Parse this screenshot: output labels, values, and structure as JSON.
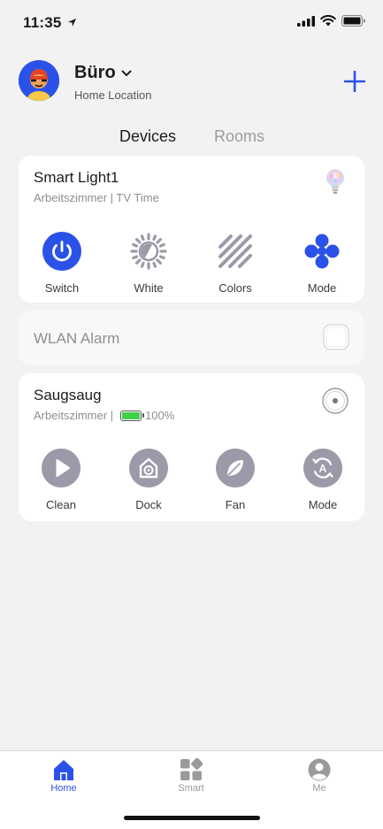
{
  "status_bar": {
    "time": "11:35"
  },
  "header": {
    "home_name": "Büro",
    "home_subtitle": "Home Location"
  },
  "tabs": [
    {
      "label": "Devices",
      "active": true
    },
    {
      "label": "Rooms",
      "active": false
    }
  ],
  "devices": [
    {
      "name": "Smart Light1",
      "subtitle": "Arbeitszimmer | TV Time",
      "actions": [
        {
          "label": "Switch",
          "icon": "power-icon",
          "active": true
        },
        {
          "label": "White",
          "icon": "brightness-icon"
        },
        {
          "label": "Colors",
          "icon": "stripes-icon"
        },
        {
          "label": "Mode",
          "icon": "mode-dots-icon",
          "active": true
        }
      ]
    },
    {
      "name": "WLAN Alarm"
    },
    {
      "name": "Saugsaug",
      "subtitle": "Arbeitszimmer |",
      "battery": "100%",
      "actions": [
        {
          "label": "Clean",
          "icon": "play-icon"
        },
        {
          "label": "Dock",
          "icon": "dock-icon"
        },
        {
          "label": "Fan",
          "icon": "leaf-icon"
        },
        {
          "label": "Mode",
          "icon": "auto-mode-icon"
        }
      ]
    }
  ],
  "bottom_nav": [
    {
      "label": "Home",
      "icon": "home-icon",
      "active": true
    },
    {
      "label": "Smart",
      "icon": "smart-grid-icon"
    },
    {
      "label": "Me",
      "icon": "profile-icon"
    }
  ],
  "colors": {
    "accent": "#2b52e8",
    "inactive_icon": "#9a9aa8",
    "background": "#f2f2f2"
  }
}
